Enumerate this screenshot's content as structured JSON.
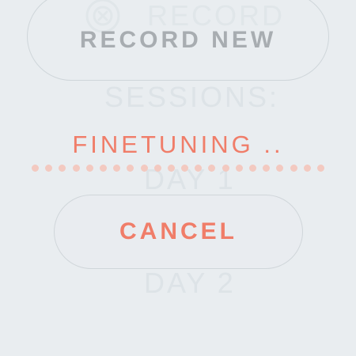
{
  "background_labels": {
    "record": "RECORD",
    "sessions": "SESSIONS:",
    "day_1": "DAY 1",
    "day_2": "DAY 2"
  },
  "record_new_button": {
    "label": "RECORD NEW"
  },
  "status": {
    "label": "FINETUNING .."
  },
  "progress_dots": {
    "count": 22,
    "color": "#f3c9c0"
  },
  "cancel_button": {
    "label": "CANCEL"
  },
  "colors": {
    "background": "#e9edf0",
    "accent": "#f07d69",
    "muted_text": "#a8adb1",
    "ghost_text": "#dde3e7"
  },
  "icons": {
    "ghost_record_icon": "close-circle-icon"
  }
}
